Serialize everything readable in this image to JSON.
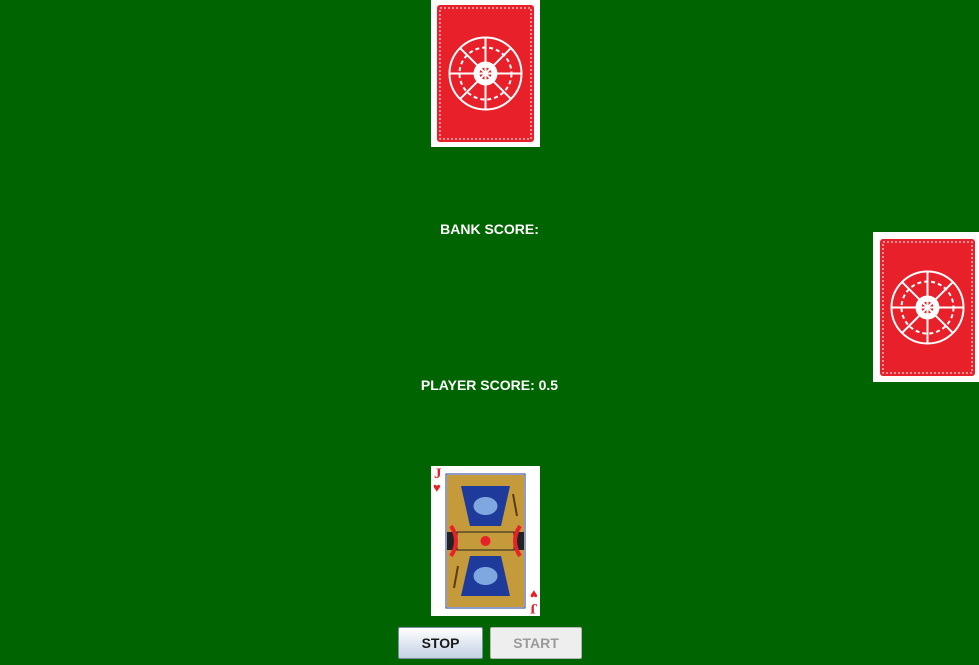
{
  "table": {
    "background_color": "#006400",
    "bank_score": {
      "label": "BANK SCORE:",
      "value": ""
    },
    "player_score": {
      "label": "PLAYER SCORE:",
      "value": "0.5"
    }
  },
  "cards": {
    "bank_card": {
      "face": "back",
      "back_color": "#e8202a"
    },
    "deck_card": {
      "face": "back",
      "back_color": "#e8202a"
    },
    "player_card": {
      "face": "up",
      "rank": "J",
      "suit": "hearts",
      "suit_color": "#e8202a"
    }
  },
  "controls": {
    "stop_label": "STOP",
    "start_label": "START",
    "start_enabled": false
  }
}
